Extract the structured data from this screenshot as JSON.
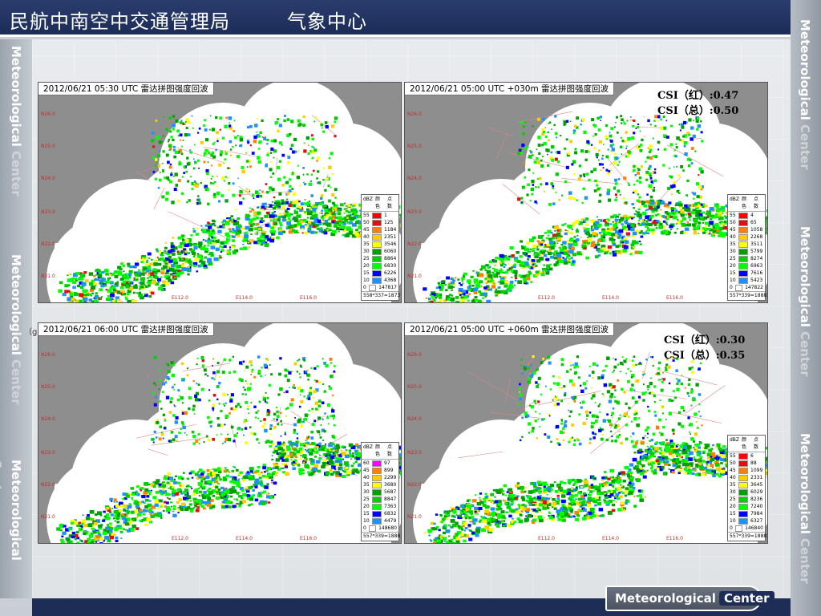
{
  "header": {
    "title": "民航中南空中交通管理局",
    "subtitle": "气象中心"
  },
  "brand": {
    "side_text_primary": "Meteorological",
    "side_text_secondary": "Center",
    "footer_text": "Meteorological",
    "footer_accent": "Center"
  },
  "side_mark": "（g）",
  "legend_header": [
    "dBZ",
    "颜色",
    "点数"
  ],
  "lat_labels": [
    "N26.0",
    "N25.0",
    "N24.0",
    "N23.0",
    "N22.0",
    "N21.0"
  ],
  "lon_labels": [
    "E112.0",
    "E114.0",
    "E116.0"
  ],
  "colors": {
    "header_bg": "#1c2c58",
    "radar_bg": "#8e8e8e",
    "csi_text": "#000000"
  },
  "panels": [
    {
      "title": "2012/06/21 05:30 UTC 雷达拼图强度回波",
      "legend": [
        {
          "dbz": "55",
          "count": "1"
        },
        {
          "dbz": "50",
          "count": "125"
        },
        {
          "dbz": "45",
          "count": "1184"
        },
        {
          "dbz": "40",
          "count": "2351"
        },
        {
          "dbz": "35",
          "count": "3546"
        },
        {
          "dbz": "30",
          "count": "6060"
        },
        {
          "dbz": "25",
          "count": "8864"
        },
        {
          "dbz": "20",
          "count": "6830"
        },
        {
          "dbz": "15",
          "count": "6226"
        },
        {
          "dbz": "10",
          "count": "4368"
        },
        {
          "dbz": "0",
          "count": "147817"
        }
      ],
      "legend_footer": "558*337=187372"
    },
    {
      "title": "2012/06/21 05:00 UTC +030m 雷达拼图强度回波",
      "legend": [
        {
          "dbz": "55",
          "count": "4"
        },
        {
          "dbz": "50",
          "count": "65"
        },
        {
          "dbz": "45",
          "count": "1058"
        },
        {
          "dbz": "40",
          "count": "2268"
        },
        {
          "dbz": "35",
          "count": "3511"
        },
        {
          "dbz": "30",
          "count": "5799"
        },
        {
          "dbz": "25",
          "count": "8274"
        },
        {
          "dbz": "20",
          "count": "6963"
        },
        {
          "dbz": "15",
          "count": "7616"
        },
        {
          "dbz": "10",
          "count": "5423"
        },
        {
          "dbz": "0",
          "count": "147822"
        }
      ],
      "legend_footer": "557*339=188823",
      "csi": [
        "CSI（红）:0.47",
        "CSI（总）:0.50"
      ]
    },
    {
      "title": "2012/06/21 06:00 UTC 雷达拼图强度回波",
      "legend": [
        {
          "dbz": "60",
          "count": "97"
        },
        {
          "dbz": "45",
          "count": "899"
        },
        {
          "dbz": "40",
          "count": "2299"
        },
        {
          "dbz": "35",
          "count": "3680"
        },
        {
          "dbz": "30",
          "count": "5687"
        },
        {
          "dbz": "25",
          "count": "8847"
        },
        {
          "dbz": "20",
          "count": "7363"
        },
        {
          "dbz": "15",
          "count": "6832"
        },
        {
          "dbz": "10",
          "count": "4479"
        },
        {
          "dbz": "0",
          "count": "148680"
        }
      ],
      "legend_footer": "557*339=188823"
    },
    {
      "title": "2012/06/21 05:00 UTC +060m 雷达拼图强度回波",
      "legend": [
        {
          "dbz": "55",
          "count": "6"
        },
        {
          "dbz": "50",
          "count": "88"
        },
        {
          "dbz": "45",
          "count": "1099"
        },
        {
          "dbz": "40",
          "count": "2331"
        },
        {
          "dbz": "35",
          "count": "3645"
        },
        {
          "dbz": "30",
          "count": "6029"
        },
        {
          "dbz": "25",
          "count": "8236"
        },
        {
          "dbz": "20",
          "count": "7240"
        },
        {
          "dbz": "15",
          "count": "7984"
        },
        {
          "dbz": "10",
          "count": "6327"
        },
        {
          "dbz": "0",
          "count": "146840"
        }
      ],
      "legend_footer": "557*339=188823",
      "csi": [
        "CSI（红）:0.30",
        "CSI（总）:0.35"
      ]
    }
  ]
}
